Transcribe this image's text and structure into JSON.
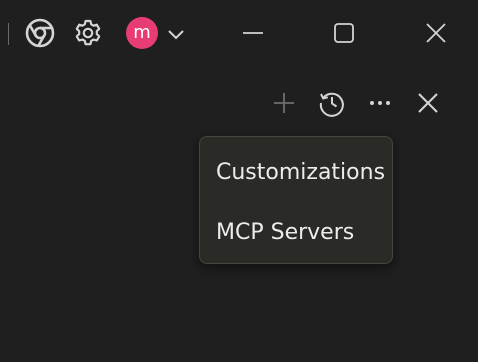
{
  "titlebar": {
    "avatar_letter": "m",
    "icons": [
      "chrome-icon",
      "gear-icon",
      "chevron-down-icon",
      "minimize-icon",
      "maximize-icon",
      "close-icon"
    ]
  },
  "panel_toolbar": {
    "icons": [
      "plus-icon",
      "history-icon",
      "more-icon",
      "close-icon"
    ]
  },
  "menu": {
    "items": [
      {
        "label": "Customizations"
      },
      {
        "label": "MCP Servers"
      }
    ]
  },
  "colors": {
    "background": "#1f1f1f",
    "avatar": "#e83d74",
    "menu_background": "#2a2a27",
    "menu_border": "#46463f",
    "icon": "#d4d4d4",
    "icon_disabled": "#6e6e6e"
  }
}
